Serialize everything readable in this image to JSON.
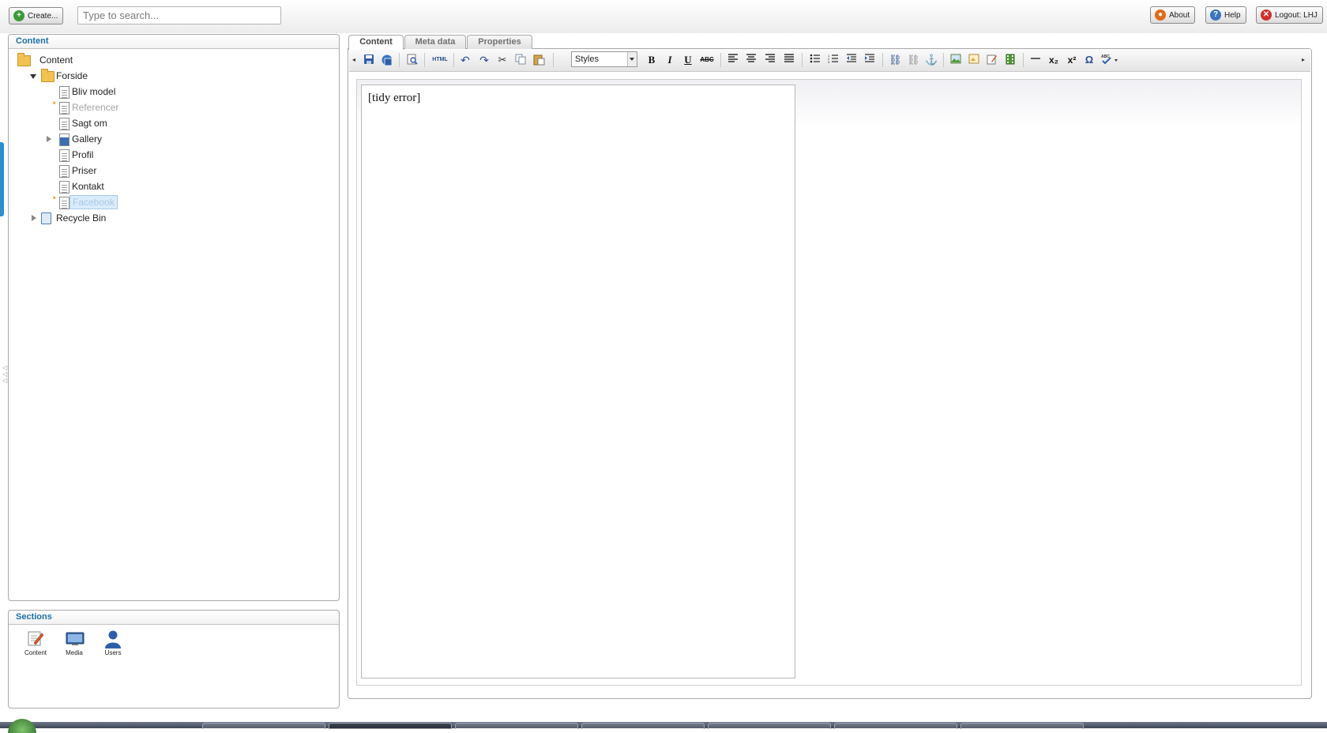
{
  "header": {
    "create_label": "Create...",
    "search_placeholder": "Type to search...",
    "about_label": "About",
    "help_label": "Help",
    "logout_label": "Logout: LHJ"
  },
  "content_panel": {
    "title": "Content",
    "tree": [
      {
        "label": "Content",
        "icon": "folder-icon"
      },
      {
        "label": "Forside",
        "icon": "folder-icon",
        "expanded": true
      },
      {
        "label": "Bliv model",
        "icon": "document-icon"
      },
      {
        "label": "Referencer",
        "icon": "document-icon",
        "unpublished": true
      },
      {
        "label": "Sagt om",
        "icon": "document-icon"
      },
      {
        "label": "Gallery",
        "icon": "gallery-icon",
        "collapsed": true
      },
      {
        "label": "Profil",
        "icon": "document-icon"
      },
      {
        "label": "Priser",
        "icon": "document-icon"
      },
      {
        "label": "Kontakt",
        "icon": "document-icon"
      },
      {
        "label": "Facebook",
        "icon": "document-icon",
        "unpublished": true,
        "selected": true
      },
      {
        "label": "Recycle Bin",
        "icon": "recycle-bin-icon",
        "collapsed": true
      }
    ]
  },
  "sections_panel": {
    "title": "Sections",
    "items": [
      {
        "label": "Content",
        "icon": "pencil-document-icon"
      },
      {
        "label": "Media",
        "icon": "monitor-icon"
      },
      {
        "label": "Users",
        "icon": "user-icon"
      }
    ]
  },
  "editor": {
    "tabs": [
      {
        "label": "Content",
        "active": true
      },
      {
        "label": "Meta data",
        "active": false
      },
      {
        "label": "Properties",
        "active": false
      }
    ],
    "toolbar": {
      "html_label": "HTML",
      "styles_value": "Styles",
      "abc_label": "ABC",
      "bold_label": "B",
      "italic_label": "I",
      "underline_label": "U"
    },
    "body_text": "[tidy error]"
  },
  "colors": {
    "accent": "#1d6fa3",
    "selected_bg": "#d9ecfb",
    "unpublished_star": "#f08a00",
    "create_icon": "#3a9a3a",
    "about_icon": "#e06a16",
    "help_icon": "#3a74c2",
    "logout_icon": "#d62c2c"
  }
}
